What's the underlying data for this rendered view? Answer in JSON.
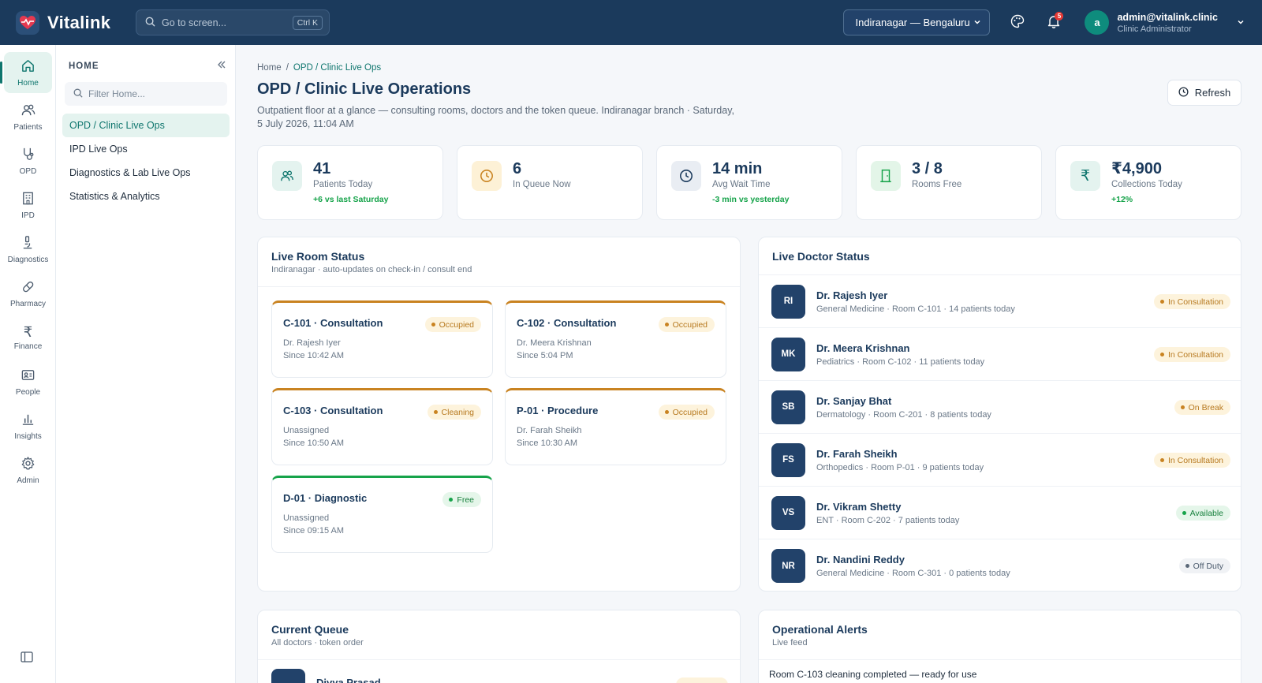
{
  "app": {
    "name": "Vitalink",
    "search_placeholder": "Go to screen...",
    "search_shortcut": "Ctrl K",
    "branch": "Indiranagar — Bengaluru",
    "notification_count": "5",
    "user": {
      "initial": "a",
      "email": "admin@vitalink.clinic",
      "role": "Clinic Administrator"
    }
  },
  "rail": {
    "items": [
      {
        "label": "Home",
        "icon": "home-icon",
        "active": true
      },
      {
        "label": "Patients",
        "icon": "users-icon"
      },
      {
        "label": "OPD",
        "icon": "stethoscope-icon"
      },
      {
        "label": "IPD",
        "icon": "building-icon"
      },
      {
        "label": "Diagnostics",
        "icon": "microscope-icon"
      },
      {
        "label": "Pharmacy",
        "icon": "pill-icon"
      },
      {
        "label": "Finance",
        "icon": "rupee-icon"
      },
      {
        "label": "People",
        "icon": "id-card-icon"
      },
      {
        "label": "Insights",
        "icon": "bar-chart-icon"
      },
      {
        "label": "Admin",
        "icon": "gear-icon"
      }
    ]
  },
  "sidenav": {
    "title": "HOME",
    "filter_placeholder": "Filter Home...",
    "items": [
      {
        "label": "OPD / Clinic Live Ops",
        "active": true
      },
      {
        "label": "IPD Live Ops"
      },
      {
        "label": "Diagnostics & Lab Live Ops"
      },
      {
        "label": "Statistics & Analytics"
      }
    ]
  },
  "page": {
    "breadcrumb": {
      "home": "Home",
      "sep": "/",
      "current": "OPD / Clinic Live Ops"
    },
    "title": "OPD / Clinic Live Operations",
    "subtitle": "Outpatient floor at a glance — consulting rooms, doctors and the token queue. Indiranagar branch · Saturday, 5 July 2026, 11:04 AM",
    "refresh_label": "Refresh"
  },
  "stats": [
    {
      "value": "41",
      "label": "Patients Today",
      "delta": "+6 vs last Saturday",
      "icon": "users-icon",
      "bg": "#e4f3ef",
      "fg": "#0f766e"
    },
    {
      "value": "6",
      "label": "In Queue Now",
      "delta": "",
      "icon": "clock-icon",
      "bg": "#fdf1d6",
      "fg": "#c98321"
    },
    {
      "value": "14 min",
      "label": "Avg Wait Time",
      "delta": "-3 min vs yesterday",
      "icon": "clock-icon",
      "bg": "#e9edf3",
      "fg": "#1b3a5c"
    },
    {
      "value": "3 / 8",
      "label": "Rooms Free",
      "delta": "",
      "icon": "door-icon",
      "bg": "#e3f5e8",
      "fg": "#16a34a"
    },
    {
      "value": "₹4,900",
      "label": "Collections Today",
      "delta": "+12%",
      "icon": "rupee-icon",
      "bg": "#e4f3ef",
      "fg": "#0f766e"
    }
  ],
  "rooms": {
    "title": "Live Room Status",
    "subtitle": "Indiranagar · auto-updates on check-in / consult end",
    "items": [
      {
        "title": "C-101 · Consultation",
        "status": "Occupied",
        "doctor": "Dr. Rajesh Iyer",
        "since": "Since 10:42 AM"
      },
      {
        "title": "C-102 · Consultation",
        "status": "Occupied",
        "doctor": "Dr. Meera Krishnan",
        "since": "Since 5:04 PM"
      },
      {
        "title": "C-103 · Consultation",
        "status": "Cleaning",
        "doctor": "Unassigned",
        "since": "Since 10:50 AM"
      },
      {
        "title": "P-01 · Procedure",
        "status": "Occupied",
        "doctor": "Dr. Farah Sheikh",
        "since": "Since 10:30 AM"
      },
      {
        "title": "D-01 · Diagnostic",
        "status": "Free",
        "doctor": "Unassigned",
        "since": "Since 09:15 AM"
      }
    ]
  },
  "doctors": {
    "title": "Live Doctor Status",
    "items": [
      {
        "initials": "RI",
        "name": "Dr. Rajesh Iyer",
        "meta": "General Medicine · Room C-101 · 14 patients today",
        "status": "In Consultation",
        "tone": "amber"
      },
      {
        "initials": "MK",
        "name": "Dr. Meera Krishnan",
        "meta": "Pediatrics · Room C-102 · 11 patients today",
        "status": "In Consultation",
        "tone": "amber"
      },
      {
        "initials": "SB",
        "name": "Dr. Sanjay Bhat",
        "meta": "Dermatology · Room C-201 · 8 patients today",
        "status": "On Break",
        "tone": "amber"
      },
      {
        "initials": "FS",
        "name": "Dr. Farah Sheikh",
        "meta": "Orthopedics · Room P-01 · 9 patients today",
        "status": "In Consultation",
        "tone": "amber"
      },
      {
        "initials": "VS",
        "name": "Dr. Vikram Shetty",
        "meta": "ENT · Room C-202 · 7 patients today",
        "status": "Available",
        "tone": "green"
      },
      {
        "initials": "NR",
        "name": "Dr. Nandini Reddy",
        "meta": "General Medicine · Room C-301 · 0 patients today",
        "status": "Off Duty",
        "tone": "gray"
      }
    ]
  },
  "queue": {
    "title": "Current Queue",
    "subtitle": "All doctors · token order",
    "first_patient": "Divya Prasad"
  },
  "alerts": {
    "title": "Operational Alerts",
    "subtitle": "Live feed",
    "first": "Room C-103 cleaning completed — ready for use"
  }
}
